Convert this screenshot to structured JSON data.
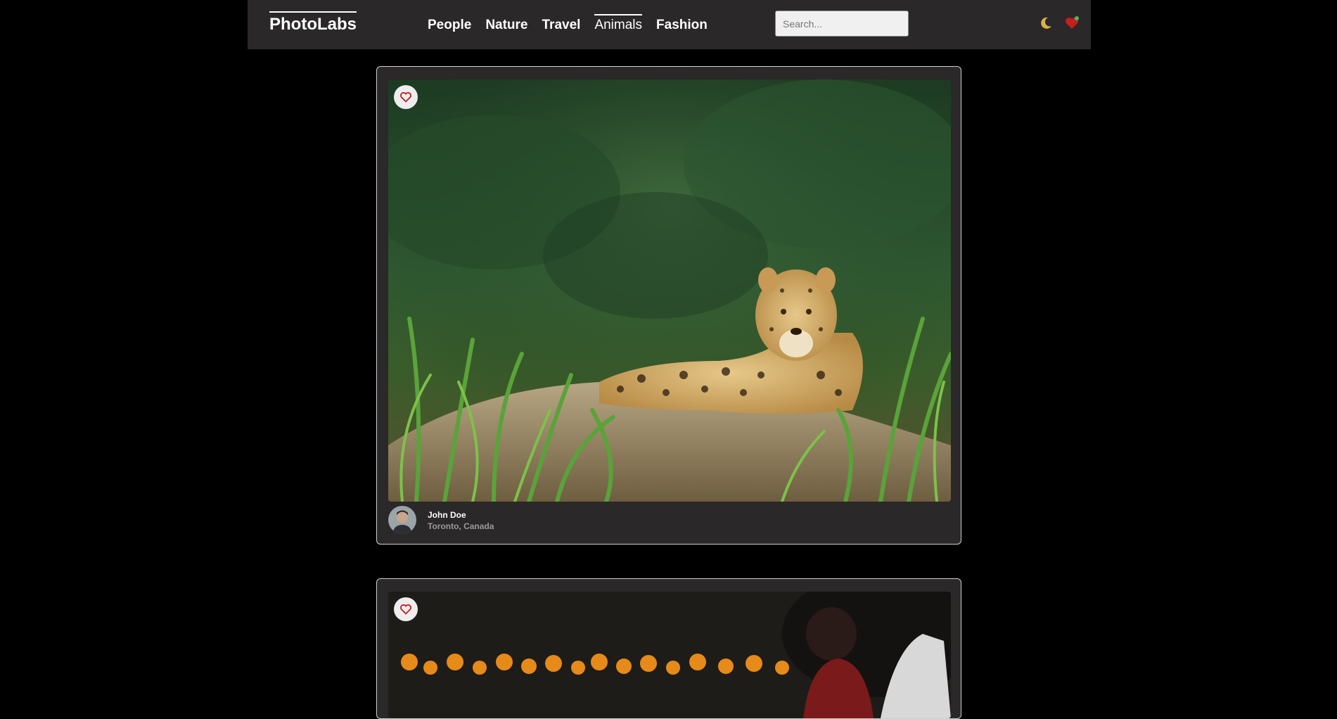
{
  "app": {
    "logo": "PhotoLabs"
  },
  "nav": {
    "topics": [
      {
        "label": "People"
      },
      {
        "label": "Nature"
      },
      {
        "label": "Travel"
      },
      {
        "label": "Animals",
        "active": true
      },
      {
        "label": "Fashion"
      }
    ],
    "search": {
      "placeholder": "Search..."
    },
    "icons": {
      "theme": "moon-icon",
      "favourites": "heart-icon"
    }
  },
  "photos": [
    {
      "user": {
        "name": "John Doe",
        "location": "Toronto, Canada"
      },
      "liked": false,
      "subject": "jaguar resting in grass"
    },
    {
      "liked": false,
      "subject": "people among marigold flowers"
    }
  ],
  "colors": {
    "background": "#000000",
    "nav_bg": "#2a2828",
    "card_bg": "#2a2828",
    "heart": "#c41e1e",
    "moon": "#d9b24a"
  }
}
